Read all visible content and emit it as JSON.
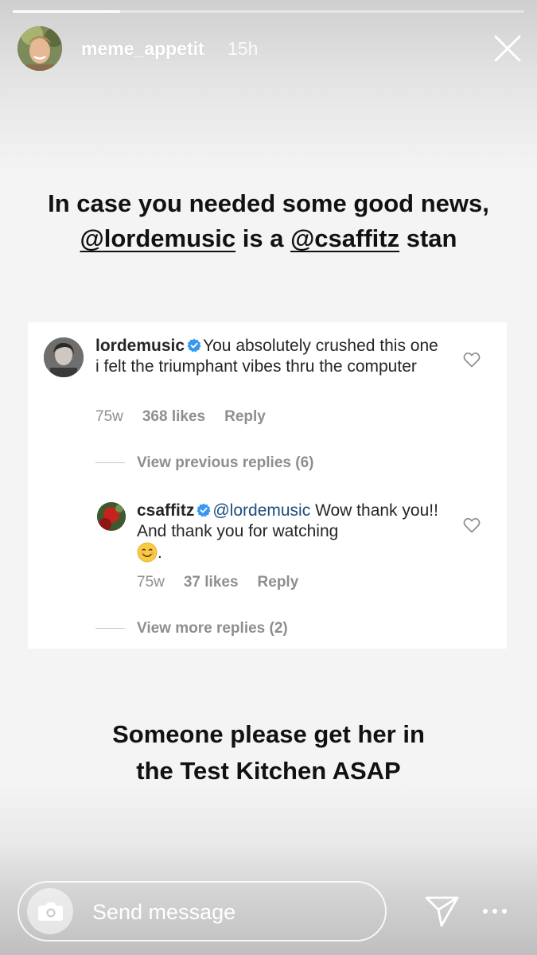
{
  "story": {
    "progress": 0.21,
    "username": "meme_appetit",
    "time": "15h"
  },
  "headline": {
    "line1": "In case you needed some good news,",
    "mention1": "@lordemusic",
    "mid": " is a ",
    "mention2": "@csaffitz",
    "end": " stan"
  },
  "comments": [
    {
      "user": "lordemusic",
      "verified": true,
      "text": "You absolutely crushed this one i felt the triumphant vibes thru the computer",
      "age": "75w",
      "likes": "368 likes",
      "reply": "Reply"
    },
    {
      "user": "csaffitz",
      "verified": true,
      "mention": "@lordemusic",
      "text": "Wow thank you!! And thank you for watching",
      "after_emoji": ".",
      "emoji": "smiling-face-emoji",
      "age": "75w",
      "likes": "37 likes",
      "reply": "Reply"
    }
  ],
  "view_previous": "View previous replies (6)",
  "view_more": "View more replies (2)",
  "subline": {
    "line1": "Someone please get her in",
    "line2": "the Test Kitchen ASAP"
  },
  "footer": {
    "message_placeholder": "Send message"
  },
  "colors": {
    "verified": "#3897f0",
    "mention": "#1d4d7a",
    "muted": "#8e8e8e"
  },
  "icons": [
    "close-icon",
    "verified-badge-icon",
    "heart-icon",
    "camera-icon",
    "send-icon",
    "more-icon"
  ]
}
